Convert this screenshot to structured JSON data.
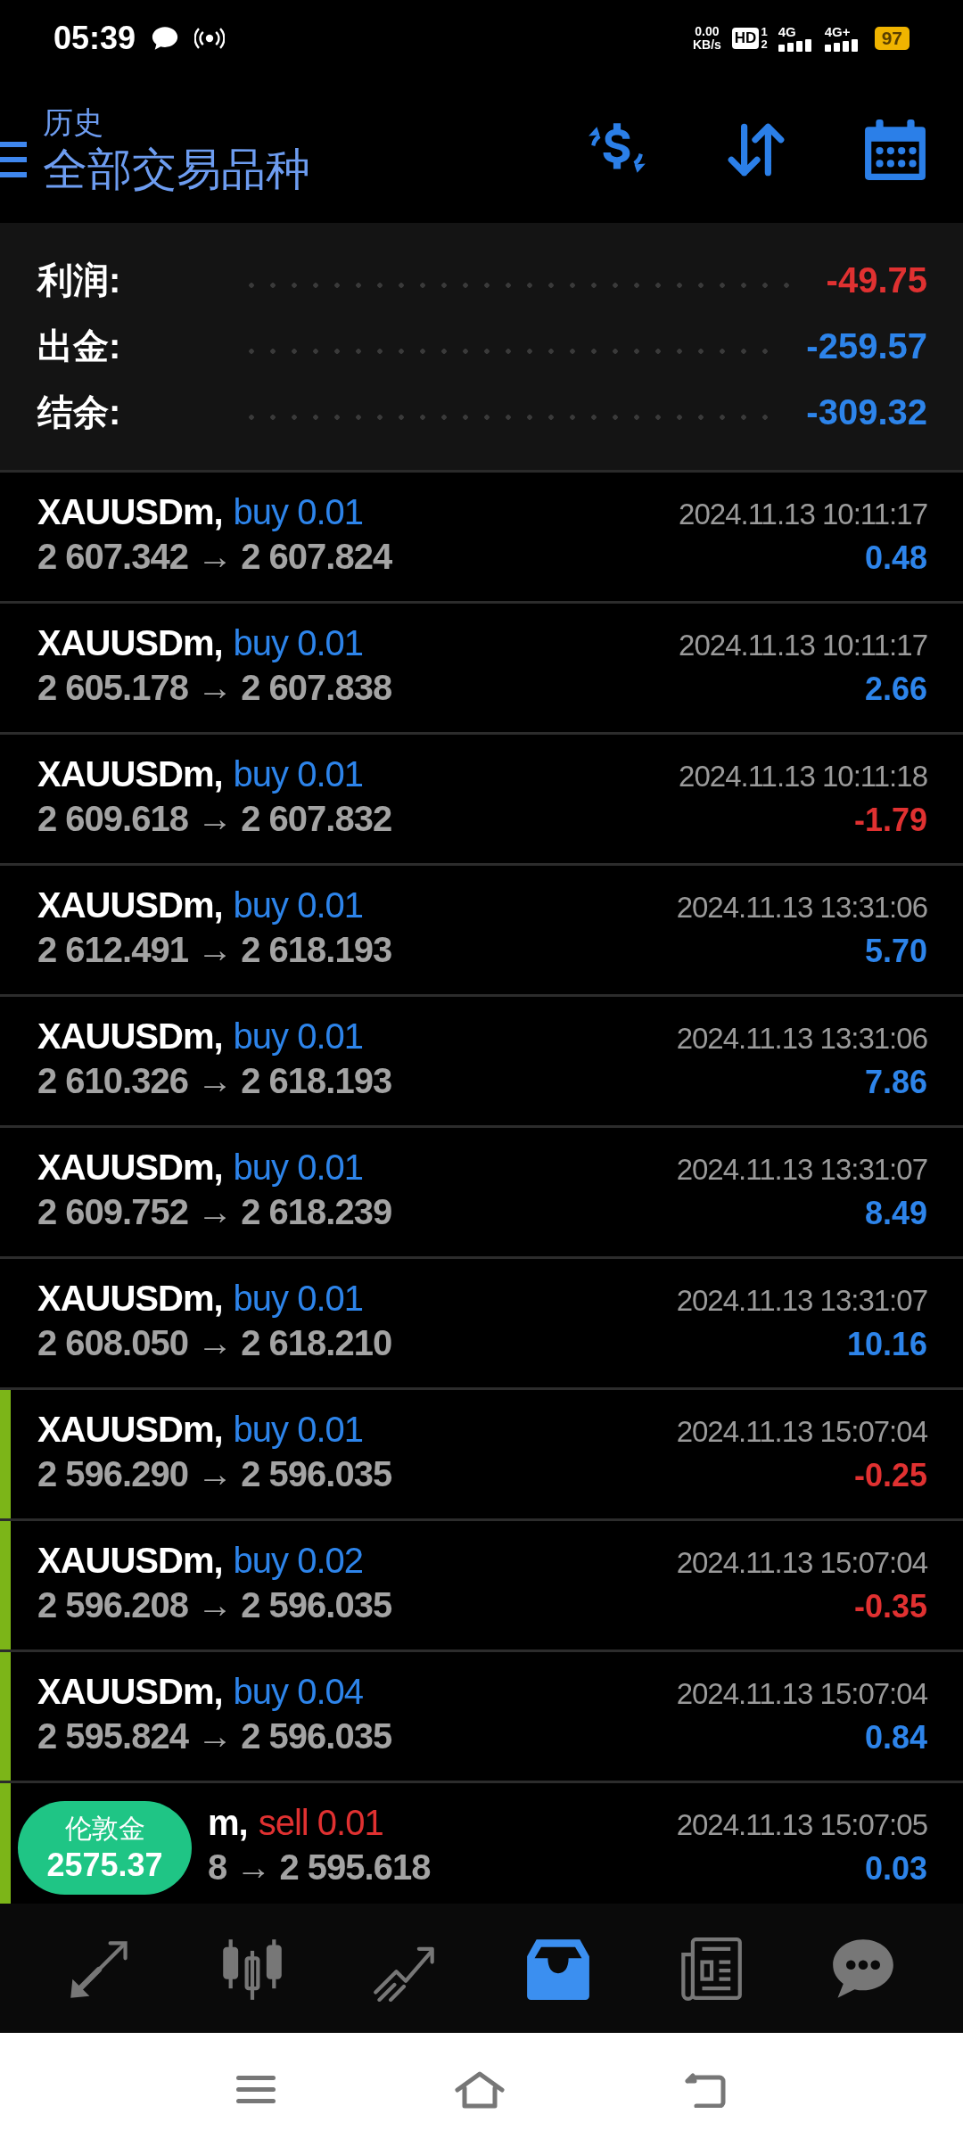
{
  "status_bar": {
    "time": "05:39",
    "net_speed": "0.00",
    "net_unit": "KB/s",
    "hd": "HD",
    "sim_1": "1",
    "sim_2": "2",
    "network_1": "4G",
    "network_2": "4G+",
    "battery": "97"
  },
  "header": {
    "subtitle": "历史",
    "title": "全部交易品种"
  },
  "summary": [
    {
      "label": "利润:",
      "value": "-49.75",
      "loss": true
    },
    {
      "label": "出金:",
      "value": "-259.57",
      "loss": false
    },
    {
      "label": "结余:",
      "value": "-309.32",
      "loss": false
    }
  ],
  "deals": [
    {
      "symbol": "XAUUSDm,",
      "sell": false,
      "type": "buy 0.01",
      "prices": "2 607.342 → 2 607.824",
      "time": "2024.11.13 10:11:17",
      "profit": "0.48",
      "loss": false,
      "highlighted": false
    },
    {
      "symbol": "XAUUSDm,",
      "sell": false,
      "type": "buy 0.01",
      "prices": "2 605.178 → 2 607.838",
      "time": "2024.11.13 10:11:17",
      "profit": "2.66",
      "loss": false,
      "highlighted": false
    },
    {
      "symbol": "XAUUSDm,",
      "sell": false,
      "type": "buy 0.01",
      "prices": "2 609.618 → 2 607.832",
      "time": "2024.11.13 10:11:18",
      "profit": "-1.79",
      "loss": true,
      "highlighted": false
    },
    {
      "symbol": "XAUUSDm,",
      "sell": false,
      "type": "buy 0.01",
      "prices": "2 612.491 → 2 618.193",
      "time": "2024.11.13 13:31:06",
      "profit": "5.70",
      "loss": false,
      "highlighted": false
    },
    {
      "symbol": "XAUUSDm,",
      "sell": false,
      "type": "buy 0.01",
      "prices": "2 610.326 → 2 618.193",
      "time": "2024.11.13 13:31:06",
      "profit": "7.86",
      "loss": false,
      "highlighted": false
    },
    {
      "symbol": "XAUUSDm,",
      "sell": false,
      "type": "buy 0.01",
      "prices": "2 609.752 → 2 618.239",
      "time": "2024.11.13 13:31:07",
      "profit": "8.49",
      "loss": false,
      "highlighted": false
    },
    {
      "symbol": "XAUUSDm,",
      "sell": false,
      "type": "buy 0.01",
      "prices": "2 608.050 → 2 618.210",
      "time": "2024.11.13 13:31:07",
      "profit": "10.16",
      "loss": false,
      "highlighted": false
    },
    {
      "symbol": "XAUUSDm,",
      "sell": false,
      "type": "buy 0.01",
      "prices": "2 596.290 → 2 596.035",
      "time": "2024.11.13 15:07:04",
      "profit": "-0.25",
      "loss": true,
      "highlighted": true
    },
    {
      "symbol": "XAUUSDm,",
      "sell": false,
      "type": "buy 0.02",
      "prices": "2 596.208 → 2 596.035",
      "time": "2024.11.13 15:07:04",
      "profit": "-0.35",
      "loss": true,
      "highlighted": true
    },
    {
      "symbol": "XAUUSDm,",
      "sell": false,
      "type": "buy 0.04",
      "prices": "2 595.824 → 2 596.035",
      "time": "2024.11.13 15:07:04",
      "profit": "0.84",
      "loss": false,
      "highlighted": true
    },
    {
      "quote_badge": {
        "name": "伦敦金",
        "price": "2575.37"
      },
      "symbol": "m,",
      "sell": true,
      "type": "sell 0.01",
      "prices": "8 → 2 595.618",
      "time": "2024.11.13 15:07:05",
      "profit": "0.03",
      "loss": false,
      "highlighted": true
    }
  ],
  "bottom_nav": [
    {
      "kind": "trade",
      "selected": false
    },
    {
      "kind": "chart",
      "selected": false
    },
    {
      "kind": "trend",
      "selected": false
    },
    {
      "kind": "history",
      "selected": true
    },
    {
      "kind": "news",
      "selected": false
    },
    {
      "kind": "chat",
      "selected": false
    }
  ]
}
